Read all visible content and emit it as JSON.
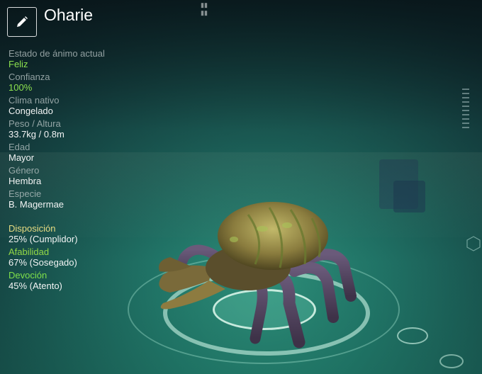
{
  "creature": {
    "name": "Oharie",
    "edit_icon": "pencil-icon"
  },
  "stats": [
    {
      "label": "Estado de ánimo actual",
      "value": "Feliz"
    },
    {
      "label": "Confianza",
      "value": "100%"
    },
    {
      "label": "Clima nativo",
      "value": "Congelado"
    },
    {
      "label": "Peso / Altura",
      "value": "33.7kg / 0.8m"
    },
    {
      "label": "Edad",
      "value": "Mayor"
    },
    {
      "label": "Género",
      "value": "Hembra"
    },
    {
      "label": "Especie",
      "value": "B. Magermae"
    }
  ],
  "traits": [
    {
      "label": "Disposición",
      "value": "25% (Cumplidor)"
    },
    {
      "label": "Afabilidad",
      "value": "67% (Sosegado)"
    },
    {
      "label": "Devoción",
      "value": "45% (Atento)"
    }
  ],
  "colors": {
    "mood_value": "#8de24f",
    "disposition_label": "#e8dc82",
    "affability_label": "#93d846",
    "devotion_label": "#7fe04a"
  }
}
